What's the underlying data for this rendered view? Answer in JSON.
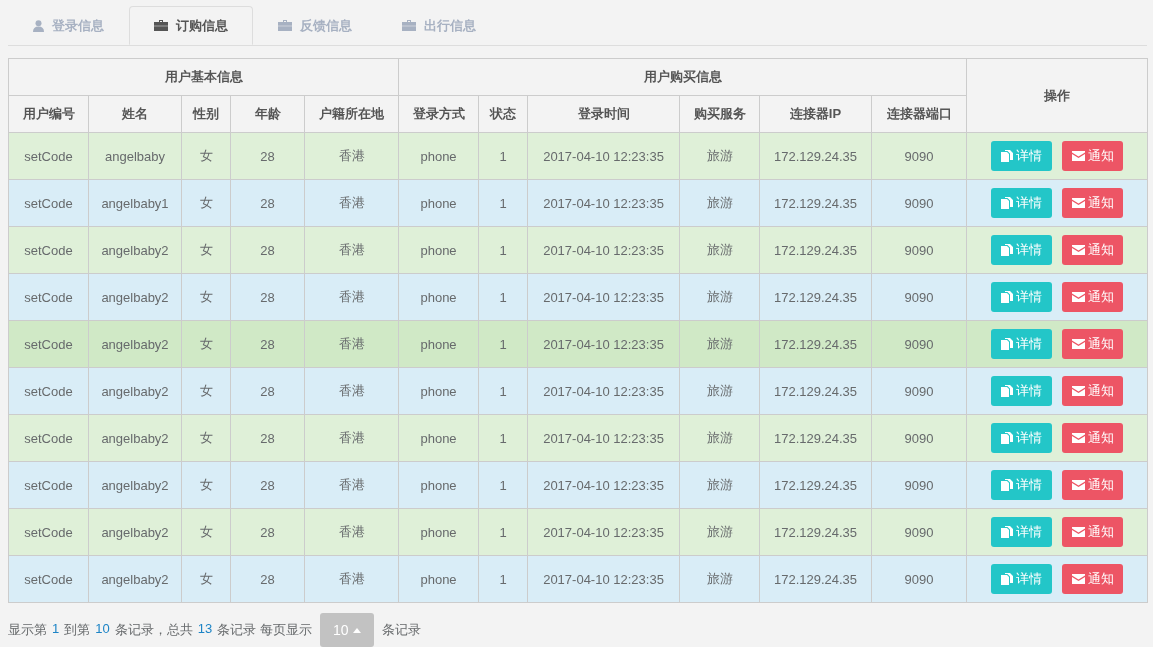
{
  "tabs": [
    {
      "label": "登录信息",
      "kind": "user",
      "selected": false
    },
    {
      "label": "订购信息",
      "kind": "briefcase",
      "selected": true
    },
    {
      "label": "反馈信息",
      "kind": "briefcase",
      "selected": false
    },
    {
      "label": "出行信息",
      "kind": "briefcase",
      "selected": false
    }
  ],
  "table": {
    "groups": [
      {
        "label": "用户基本信息"
      },
      {
        "label": "用户购买信息"
      }
    ],
    "action_header": "操作",
    "columns": [
      "用户编号",
      "姓名",
      "性别",
      "年龄",
      "户籍所在地",
      "登录方式",
      "状态",
      "登录时间",
      "购买服务",
      "连接器IP",
      "连接器端口"
    ],
    "rows": [
      {
        "color": "#dff0d8",
        "cells": [
          "setCode",
          "angelbaby",
          "女",
          "28",
          "香港",
          "phone",
          "1",
          "2017-04-10 12:23:35",
          "旅游",
          "172.129.24.35",
          "9090"
        ],
        "actions": [
          "详情",
          "通知"
        ]
      },
      {
        "color": "#d9edf7",
        "cells": [
          "setCode",
          "angelbaby1",
          "女",
          "28",
          "香港",
          "phone",
          "1",
          "2017-04-10 12:23:35",
          "旅游",
          "172.129.24.35",
          "9090"
        ],
        "actions": [
          "详情",
          "通知"
        ]
      },
      {
        "color": "#dff0d8",
        "cells": [
          "setCode",
          "angelbaby2",
          "女",
          "28",
          "香港",
          "phone",
          "1",
          "2017-04-10 12:23:35",
          "旅游",
          "172.129.24.35",
          "9090"
        ],
        "actions": [
          "详情",
          "通知"
        ]
      },
      {
        "color": "#d9edf7",
        "cells": [
          "setCode",
          "angelbaby2",
          "女",
          "28",
          "香港",
          "phone",
          "1",
          "2017-04-10 12:23:35",
          "旅游",
          "172.129.24.35",
          "9090"
        ],
        "actions": [
          "详情",
          "通知"
        ]
      },
      {
        "color": "#d0e9c6",
        "cells": [
          "setCode",
          "angelbaby2",
          "女",
          "28",
          "香港",
          "phone",
          "1",
          "2017-04-10 12:23:35",
          "旅游",
          "172.129.24.35",
          "9090"
        ],
        "actions": [
          "详情",
          "通知"
        ]
      },
      {
        "color": "#d9edf7",
        "cells": [
          "setCode",
          "angelbaby2",
          "女",
          "28",
          "香港",
          "phone",
          "1",
          "2017-04-10 12:23:35",
          "旅游",
          "172.129.24.35",
          "9090"
        ],
        "actions": [
          "详情",
          "通知"
        ]
      },
      {
        "color": "#dff0d8",
        "cells": [
          "setCode",
          "angelbaby2",
          "女",
          "28",
          "香港",
          "phone",
          "1",
          "2017-04-10 12:23:35",
          "旅游",
          "172.129.24.35",
          "9090"
        ],
        "actions": [
          "详情",
          "通知"
        ]
      },
      {
        "color": "#d9edf7",
        "cells": [
          "setCode",
          "angelbaby2",
          "女",
          "28",
          "香港",
          "phone",
          "1",
          "2017-04-10 12:23:35",
          "旅游",
          "172.129.24.35",
          "9090"
        ],
        "actions": [
          "详情",
          "通知"
        ]
      },
      {
        "color": "#dff0d8",
        "cells": [
          "setCode",
          "angelbaby2",
          "女",
          "28",
          "香港",
          "phone",
          "1",
          "2017-04-10 12:23:35",
          "旅游",
          "172.129.24.35",
          "9090"
        ],
        "actions": [
          "详情",
          "通知"
        ]
      },
      {
        "color": "#d9edf7",
        "cells": [
          "setCode",
          "angelbaby2",
          "女",
          "28",
          "香港",
          "phone",
          "1",
          "2017-04-10 12:23:35",
          "旅游",
          "172.129.24.35",
          "9090"
        ],
        "actions": [
          "详情",
          "通知"
        ]
      }
    ]
  },
  "pagination": {
    "segments": [
      {
        "kind": "text",
        "text": "显示第"
      },
      {
        "kind": "number",
        "text": "1"
      },
      {
        "kind": "text",
        "text": "到第"
      },
      {
        "kind": "number",
        "text": "10"
      },
      {
        "kind": "text",
        "text": "条记录，总共"
      },
      {
        "kind": "number",
        "text": "13"
      },
      {
        "kind": "text",
        "text": "条记录 每页显示"
      }
    ],
    "page_size": "10",
    "suffix": "条记录"
  }
}
